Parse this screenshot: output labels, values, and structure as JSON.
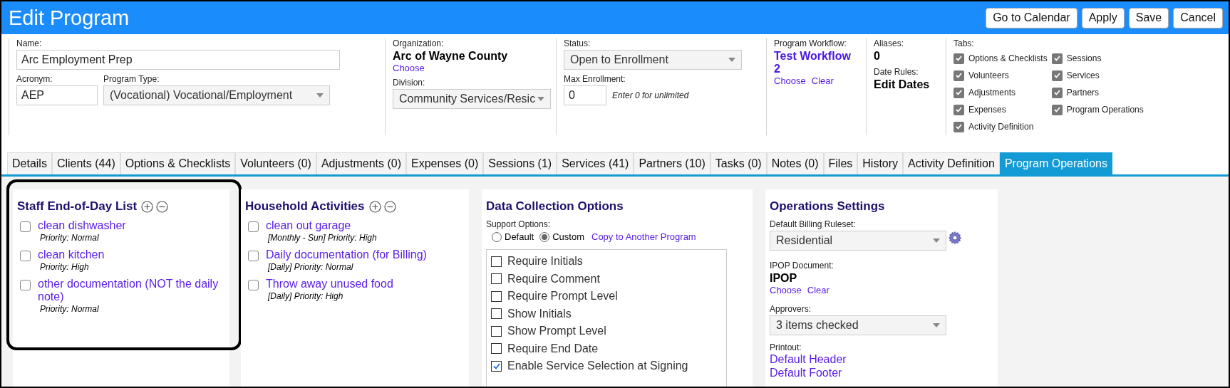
{
  "header": {
    "title": "Edit Program",
    "buttons": [
      "Go to Calendar",
      "Apply",
      "Save",
      "Cancel"
    ]
  },
  "form": {
    "name": {
      "label": "Name:",
      "value": "Arc Employment Prep"
    },
    "acronym": {
      "label": "Acronym:",
      "value": "AEP"
    },
    "program_type": {
      "label": "Program Type:",
      "value": "(Vocational) Vocational/Employment"
    },
    "organization": {
      "label": "Organization:",
      "value": "Arc of Wayne County",
      "links": [
        "Choose"
      ]
    },
    "division": {
      "label": "Division:",
      "value": "Community Services/Resic"
    },
    "status": {
      "label": "Status:",
      "value": "Open to Enrollment"
    },
    "max_enrollment": {
      "label": "Max Enrollment:",
      "value": "0",
      "hint": "Enter 0 for unlimited"
    },
    "workflow": {
      "label": "Program Workflow:",
      "value": "Test Workflow 2",
      "links": [
        "Choose",
        "Clear"
      ]
    },
    "aliases": {
      "label": "Aliases:",
      "value": "0"
    },
    "date_rules": {
      "label": "Date Rules:",
      "value": "Edit Dates"
    },
    "tab_options": {
      "label": "Tabs:",
      "items": [
        {
          "label": "Options & Checklists",
          "checked": true
        },
        {
          "label": "Volunteers",
          "checked": true
        },
        {
          "label": "Adjustments",
          "checked": true
        },
        {
          "label": "Expenses",
          "checked": true
        },
        {
          "label": "Activity Definition",
          "checked": true
        },
        {
          "label": "Sessions",
          "checked": true
        },
        {
          "label": "Services",
          "checked": true
        },
        {
          "label": "Partners",
          "checked": true
        },
        {
          "label": "Program Operations",
          "checked": true
        }
      ]
    }
  },
  "tabs": [
    {
      "label": "Details",
      "selected": false
    },
    {
      "label": "Clients (44)",
      "selected": false
    },
    {
      "label": "Options & Checklists",
      "selected": false
    },
    {
      "label": "Volunteers (0)",
      "selected": false
    },
    {
      "label": "Adjustments (0)",
      "selected": false
    },
    {
      "label": "Expenses (0)",
      "selected": false
    },
    {
      "label": "Sessions (1)",
      "selected": false
    },
    {
      "label": "Services (41)",
      "selected": false
    },
    {
      "label": "Partners (10)",
      "selected": false
    },
    {
      "label": "Tasks (0)",
      "selected": false
    },
    {
      "label": "Notes (0)",
      "selected": false
    },
    {
      "label": "Files",
      "selected": false
    },
    {
      "label": "History",
      "selected": false
    },
    {
      "label": "Activity Definition",
      "selected": false
    },
    {
      "label": "Program Operations",
      "selected": true
    }
  ],
  "checklists": [
    {
      "title": "Staff End-of-Day List",
      "highlighted": true,
      "items": [
        {
          "label": "clean dishwasher",
          "detail": "Priority: Normal",
          "checked": false
        },
        {
          "label": "clean kitchen",
          "detail": "Priority: High",
          "checked": false
        },
        {
          "label": "other documentation (NOT the daily note)",
          "detail": "Priority: Normal",
          "checked": false
        }
      ]
    },
    {
      "title": "Household Activities",
      "highlighted": false,
      "items": [
        {
          "label": "clean out garage",
          "detail": "[Monthly - Sun] Priority: High",
          "checked": false
        },
        {
          "label": "Daily documentation (for Billing)",
          "detail": "[Daily] Priority: Normal",
          "checked": false
        },
        {
          "label": "Throw away unused food",
          "detail": "[Daily] Priority: High",
          "checked": false
        }
      ]
    }
  ],
  "data_collection": {
    "title": "Data Collection Options",
    "support_label": "Support Options:",
    "radios": [
      {
        "label": "Default",
        "selected": false
      },
      {
        "label": "Custom",
        "selected": true
      }
    ],
    "copy_link": "Copy to Another Program",
    "options": [
      {
        "label": "Require Initials",
        "checked": false
      },
      {
        "label": "Require Comment",
        "checked": false
      },
      {
        "label": "Require Prompt Level",
        "checked": false
      },
      {
        "label": "Show Initials",
        "checked": false
      },
      {
        "label": "Show Prompt Level",
        "checked": false
      },
      {
        "label": "Require End Date",
        "checked": false
      },
      {
        "label": "Enable Service Selection at Signing",
        "checked": true
      }
    ]
  },
  "operations": {
    "title": "Operations Settings",
    "ruleset": {
      "label": "Default Billing Ruleset:",
      "value": "Residential"
    },
    "ipop": {
      "label": "IPOP Document:",
      "value": "IPOP",
      "links": [
        "Choose",
        "Clear"
      ]
    },
    "approvers": {
      "label": "Approvers:",
      "value": "3 items checked"
    },
    "printout": {
      "label": "Printout:",
      "links": [
        "Default Header",
        "Default Footer"
      ]
    }
  }
}
